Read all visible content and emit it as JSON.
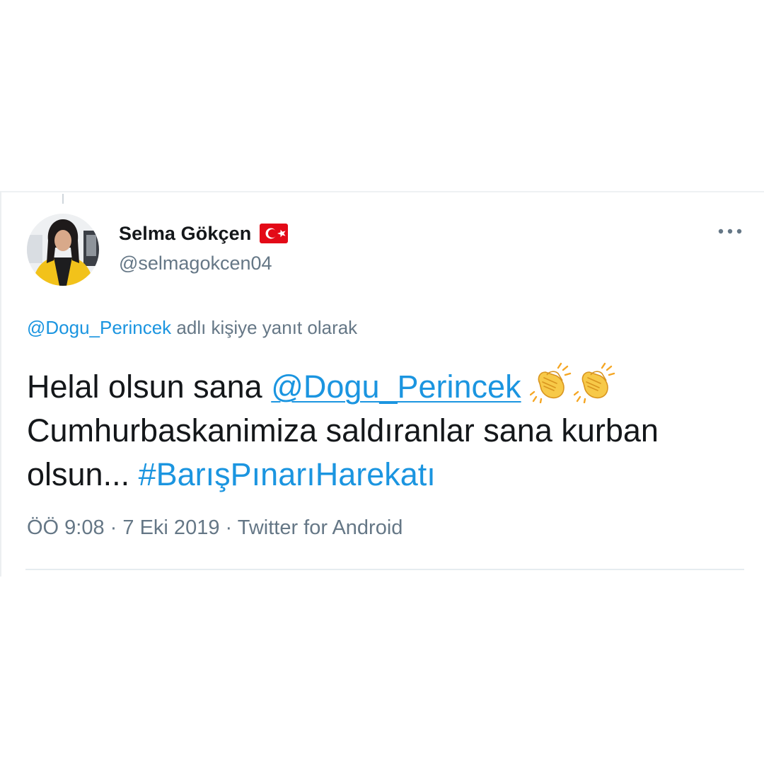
{
  "tweet": {
    "author": {
      "display_name": "Selma Gökçen",
      "handle": "@selmagokcen04",
      "avatar_icon": "profile-photo-avatar",
      "flag_icon": "turkey-flag-icon"
    },
    "more_icon": "more-options-icon",
    "reply_context": {
      "mention": "@Dogu_Perincek",
      "suffix": " adlı kişiye yanıt olarak"
    },
    "text": {
      "part1": "Helal olsun sana ",
      "mention": "@Dogu_Perincek",
      "clap_icon": "clapping-hands-emoji",
      "part2": "Cumhurbaskanimiza saldıranlar sana kurban olsun...  ",
      "hashtag": "#BarışPınarıHarekatı"
    },
    "meta": {
      "time": "ÖÖ 9:08",
      "separator1": " · ",
      "date": "7 Eki 2019",
      "separator2": " · ",
      "source": "Twitter for Android"
    }
  },
  "colors": {
    "link": "#1b95e0",
    "text": "#14171a",
    "secondary": "#657786",
    "flag_red": "#e30a17",
    "divider": "#e6ecf0"
  }
}
